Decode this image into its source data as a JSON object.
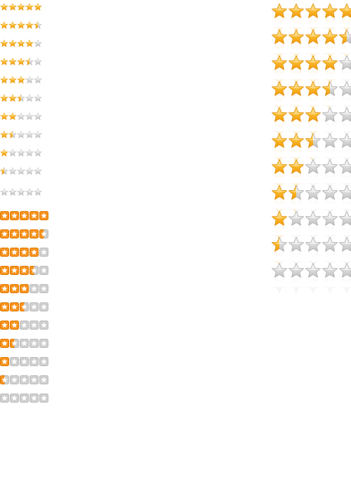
{
  "rating_sets": [
    {
      "name": "small-star-ratings",
      "style": "small-gradient-stars",
      "max_stars": 5,
      "ratings": [
        5,
        4.5,
        4,
        3.5,
        3,
        2.5,
        2,
        1.5,
        1,
        0.5,
        0
      ]
    },
    {
      "name": "boxed-star-ratings",
      "style": "orange-boxed-stars",
      "max_stars": 5,
      "ratings": [
        5,
        4.5,
        4,
        3.5,
        3,
        2.5,
        2,
        1.5,
        1,
        0.5,
        0
      ]
    },
    {
      "name": "large-star-ratings",
      "style": "large-glossy-stars-with-reflection",
      "max_stars": 5,
      "ratings": [
        5,
        4.5,
        4,
        3.5,
        3,
        2.5,
        2,
        1.5,
        1,
        0.5,
        0
      ]
    }
  ],
  "colors": {
    "star_gold_light": "#ffd54a",
    "star_gold_dark": "#f29a0a",
    "star_outline_gold": "#e08a00",
    "star_gray_light": "#f2f2f2",
    "star_gray_dark": "#c2c2c2",
    "star_outline_gray": "#a8a8a8",
    "box_orange": "#f7931e",
    "box_border_orange": "#e07b00",
    "box_gray": "#cfcfcf",
    "box_border_gray": "#bdbdbd",
    "background": "#ffffff"
  }
}
